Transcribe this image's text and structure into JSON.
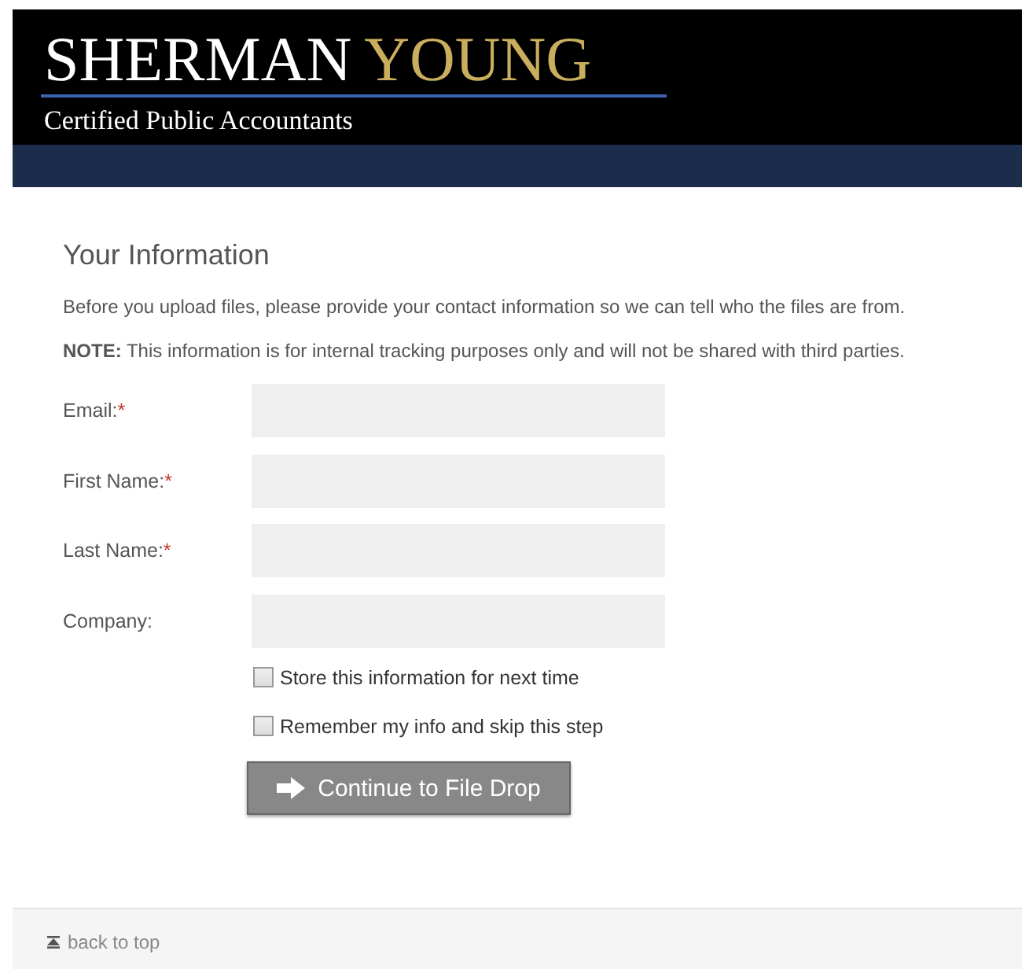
{
  "header": {
    "logo_first": "SHERMAN",
    "logo_second": "YOUNG",
    "tagline": "Certified Public Accountants"
  },
  "form": {
    "title": "Your Information",
    "intro": "Before you upload files, please provide your contact information so we can tell who the files are from.",
    "note": "**NOTE:** This information is for internal tracking purposes only and will not be shared with third parties.",
    "fields": [
      {
        "label": "Email:",
        "required_mark": "*"
      },
      {
        "label": "First Name:",
        "required_mark": "*"
      },
      {
        "label": "Last Name:",
        "required_mark": "*"
      },
      {
        "label": "Company:"
      }
    ],
    "checkboxes": [
      {
        "label": "Store this information for next time",
        "checked": false
      },
      {
        "label": "Remember my info and skip this step",
        "checked": false
      }
    ],
    "submit": "Continue to File Drop"
  },
  "footer": {
    "back_to_top": "back to top"
  }
}
